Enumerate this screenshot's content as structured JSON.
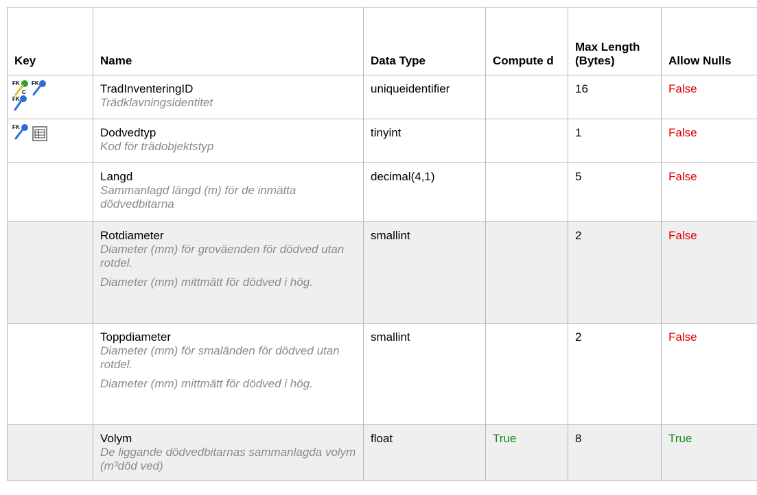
{
  "headers": {
    "key": "Key",
    "name": "Name",
    "data_type": "Data Type",
    "computed": "Compute d",
    "max_length": "Max Length (Bytes)",
    "allow_nulls": "Allow Nulls"
  },
  "rows": [
    {
      "name": "TradInventeringID",
      "desc": [
        "Trädklavningsidentitet"
      ],
      "data_type": "uniqueidentifier",
      "computed": "",
      "max_length": "16",
      "allow_nulls": "False",
      "keys": [
        "fk-icon",
        "fk-icon",
        "fk-icon",
        "computed-icon"
      ]
    },
    {
      "name": "Dodvedtyp",
      "desc": [
        "Kod för trädobjektstyp"
      ],
      "data_type": "tinyint",
      "computed": "",
      "max_length": "1",
      "allow_nulls": "False",
      "keys": [
        "fk-icon",
        "lookup-table-icon"
      ]
    },
    {
      "name": "Langd",
      "desc": [
        "Sammanlagd längd (m) för de inmätta dödvedbitarna"
      ],
      "data_type": "decimal(4,1)",
      "computed": "",
      "max_length": "5",
      "allow_nulls": "False",
      "keys": []
    },
    {
      "name": "Rotdiameter",
      "desc": [
        "Diameter (mm) för groväenden för dödved utan rotdel.",
        "Diameter (mm) mittmätt för dödved i hög."
      ],
      "data_type": "smallint",
      "computed": "",
      "max_length": "2",
      "allow_nulls": "False",
      "keys": []
    },
    {
      "name": "Toppdiameter",
      "desc": [
        "Diameter (mm) för smaländen för dödved utan rotdel.",
        "Diameter (mm) mittmätt för dödved i hög."
      ],
      "data_type": "smallint",
      "computed": "",
      "max_length": "2",
      "allow_nulls": "False",
      "keys": []
    },
    {
      "name": "Volym",
      "desc": [
        "De liggande dödvedbitarnas sammanlagda volym (m³död ved)"
      ],
      "data_type": "float",
      "computed": "True",
      "max_length": "8",
      "allow_nulls": "True",
      "keys": []
    }
  ],
  "colors": {
    "false": "#e00000",
    "true": "#138a13",
    "key_blue": "#2a6fd6",
    "key_green": "#2fa02f",
    "key_yellow": "#e0c020"
  }
}
